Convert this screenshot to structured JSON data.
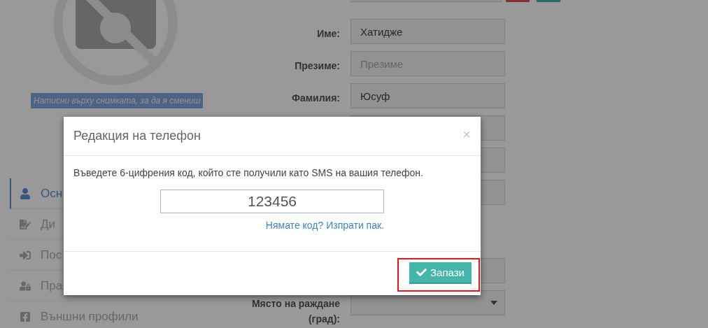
{
  "profile": {
    "photo_caption": "Натисни върху снимката, за да я смениш"
  },
  "sidebar": {
    "items": [
      {
        "label": "Осн",
        "selected": true
      },
      {
        "label": "Ди",
        "selected": false
      },
      {
        "label": "Пос",
        "selected": false
      },
      {
        "label": "Пра",
        "selected": false
      },
      {
        "label": "Външни профили",
        "selected": false
      }
    ]
  },
  "form": {
    "fields": [
      {
        "kind": "text",
        "label": "Име:",
        "value": "Хатидже"
      },
      {
        "kind": "text",
        "label": "Презиме:",
        "placeholder": "Презиме"
      },
      {
        "kind": "text",
        "label": "Фамилия:",
        "value": "Юсуф"
      },
      {
        "kind": "text"
      },
      {
        "kind": "text"
      },
      {
        "kind": "text"
      }
    ],
    "more_fields": [
      {
        "kind": "text"
      },
      {
        "kind": "select",
        "label": "Място на раждане (град):"
      }
    ]
  },
  "dialog": {
    "title": "Редакция на телефон",
    "close": "×",
    "message": "Въведете 6-цифрения код, който сте получили като SMS на вашия телефон.",
    "code": {
      "value": "123456"
    },
    "resend_link": "Нямате код? Изпрати пак.",
    "save_button": {
      "label": "Запази",
      "highlighted": true
    }
  }
}
